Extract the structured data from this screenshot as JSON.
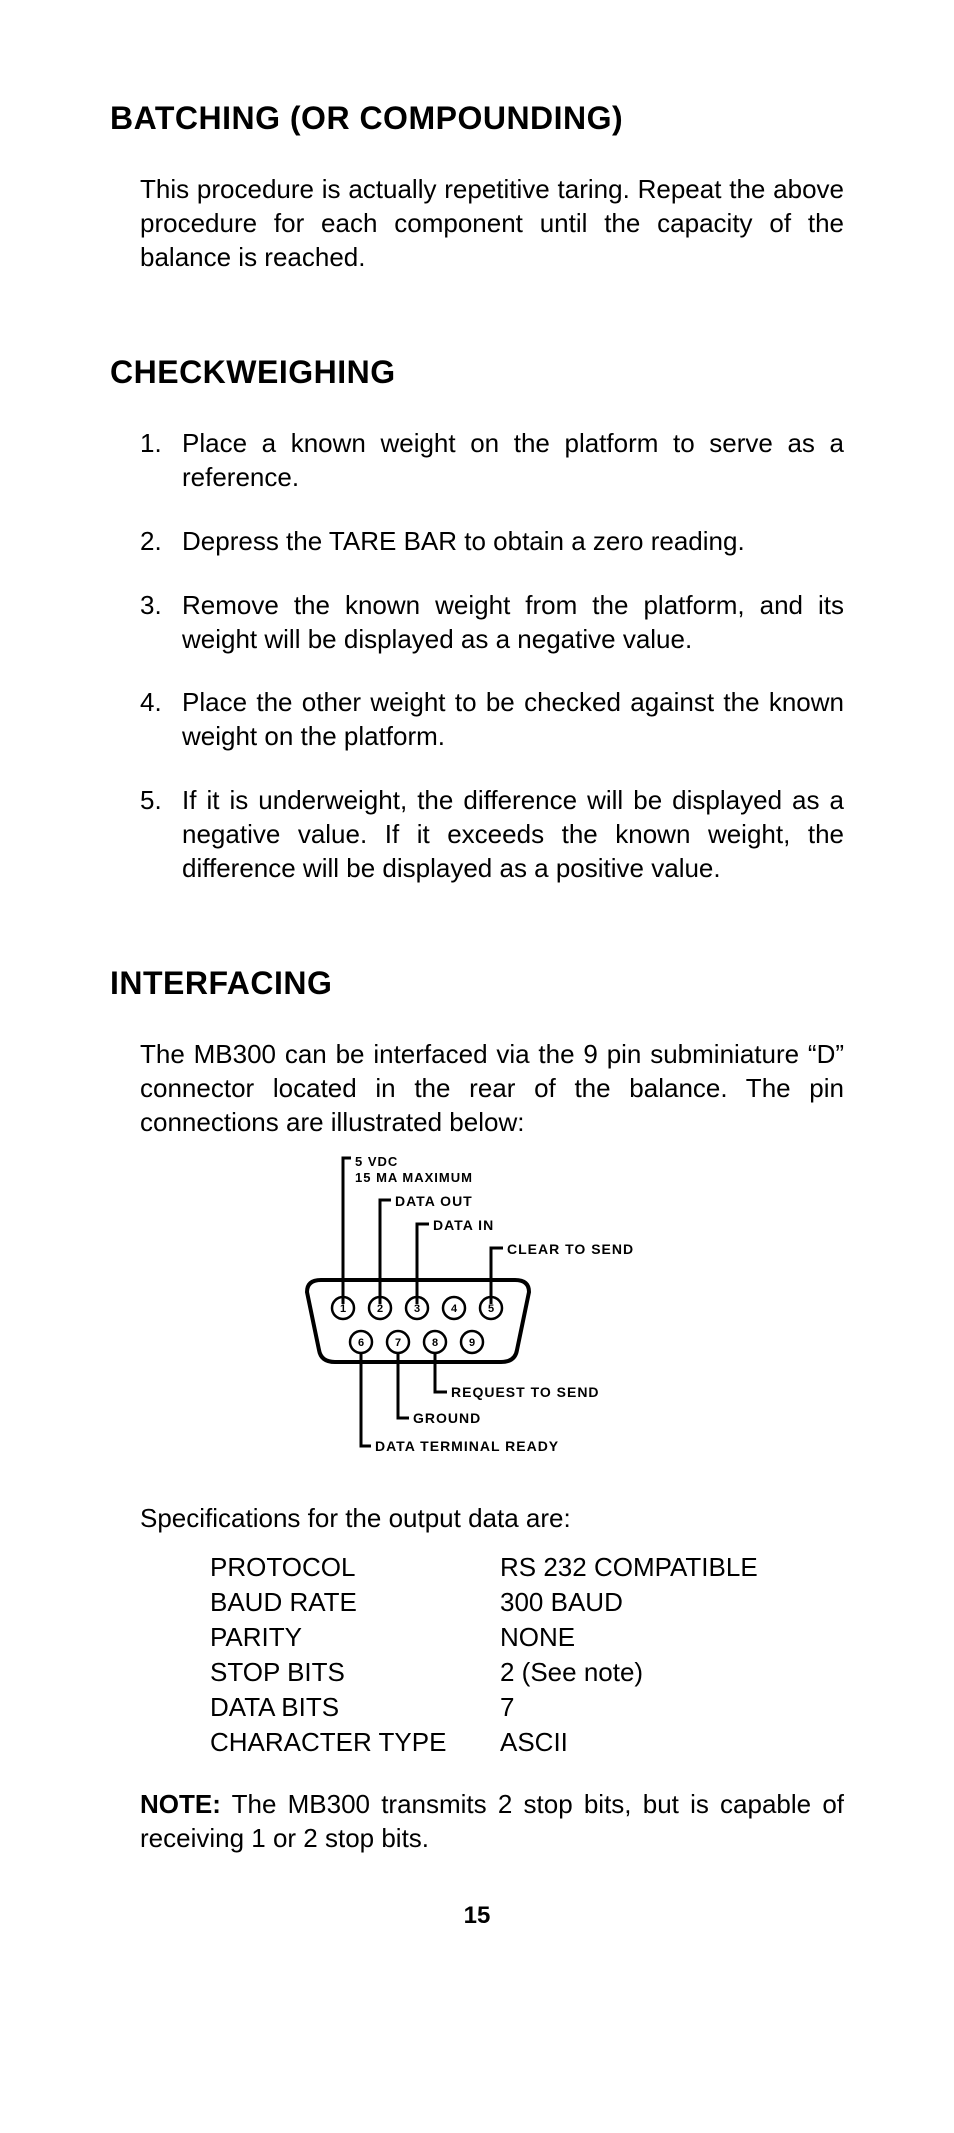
{
  "sections": {
    "batching": {
      "title": "BATCHING (OR COMPOUNDING)",
      "para": "This procedure is actually repetitive taring. Repeat the above procedure for each component until the capacity of the balance is reached."
    },
    "checkweighing": {
      "title": "CHECKWEIGHING",
      "steps": [
        "Place a known weight on the platform to serve as a reference.",
        "Depress the TARE BAR to obtain a zero reading.",
        "Remove the known weight from the platform, and its weight will be displayed as a negative value.",
        "Place the other weight to be checked against the known weight on the platform.",
        "If it is underweight, the difference will be dis­played as a negative value. If it exceeds the known weight, the difference will be displayed as a positive value."
      ]
    },
    "interfacing": {
      "title": "INTERFACING",
      "para": "The MB300 can be interfaced via the 9 pin sub­miniature “D” connector located in the rear of the balance. The pin connections are illustrated below:",
      "pins": {
        "p1a": "5 VDC",
        "p1b": "15 MA MAXIMUM",
        "p2": "DATA OUT",
        "p3": "DATA IN",
        "p5": "CLEAR TO SEND",
        "p6": "DATA TERMINAL READY",
        "p7": "GROUND",
        "p8": "REQUEST TO SEND"
      },
      "spec_intro": "Specifications for the output data are:",
      "specs": [
        {
          "k": "PROTOCOL",
          "v": "RS 232 COMPATIBLE"
        },
        {
          "k": "BAUD RATE",
          "v": "300 BAUD"
        },
        {
          "k": "PARITY",
          "v": "NONE"
        },
        {
          "k": "STOP BITS",
          "v": "2 (See note)"
        },
        {
          "k": "DATA BITS",
          "v": "7"
        },
        {
          "k": "CHARACTER TYPE",
          "v": "ASCII"
        }
      ],
      "note_label": "NOTE:",
      "note_body": " The MB300 transmits 2 stop bits, but is capable of receiving 1 or 2 stop bits."
    }
  },
  "page_number": "15"
}
